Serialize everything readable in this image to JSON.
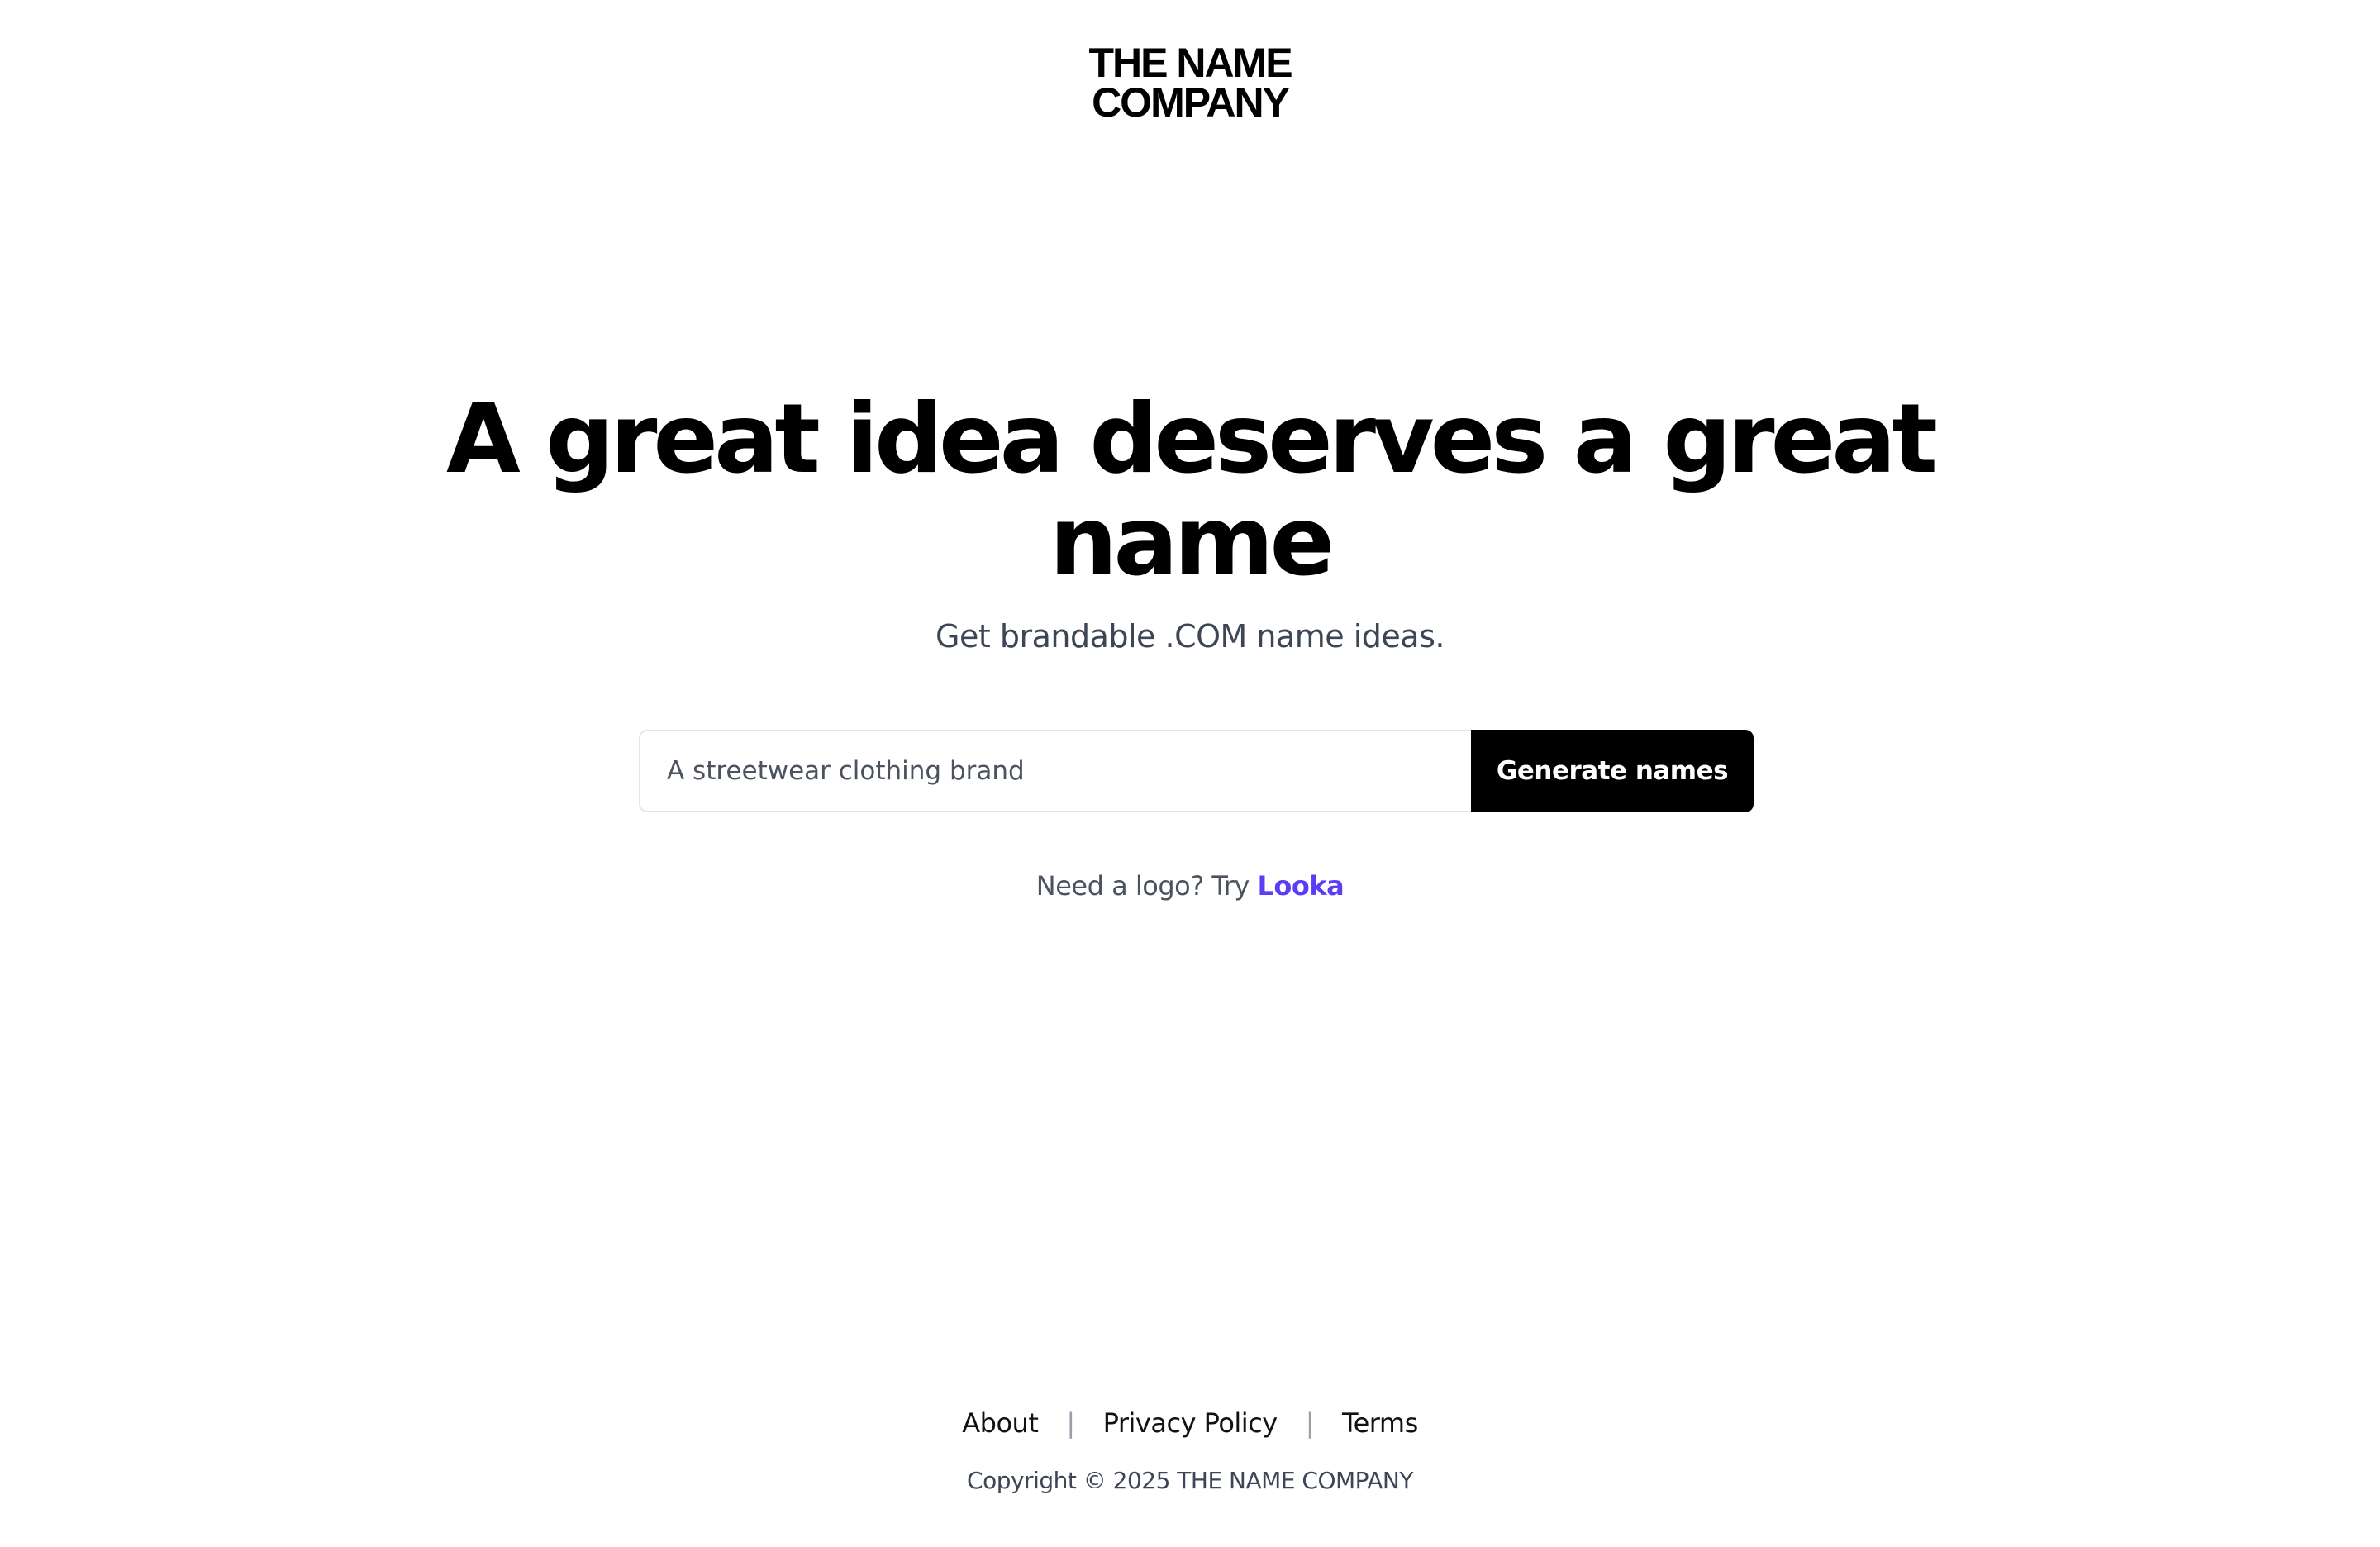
{
  "header": {
    "logo_line1": "THE NAME",
    "logo_line2": "COMPANY"
  },
  "hero": {
    "headline": "A great idea deserves a great name",
    "subtitle": "Get brandable .COM name ideas."
  },
  "search": {
    "placeholder": "A streetwear clothing brand",
    "value": "",
    "button_label": "Generate names"
  },
  "logo_hint": {
    "prefix": "Need a logo? Try ",
    "link_label": "Looka",
    "link_color": "#5b3df5"
  },
  "footer": {
    "links": [
      "About",
      "Privacy Policy",
      "Terms"
    ],
    "separator": "|",
    "copyright": "Copyright © 2025 THE NAME COMPANY"
  },
  "colors": {
    "background": "#ffffff",
    "text": "#000000",
    "muted": "#3d4656",
    "button_bg": "#000000",
    "button_text": "#ffffff"
  }
}
